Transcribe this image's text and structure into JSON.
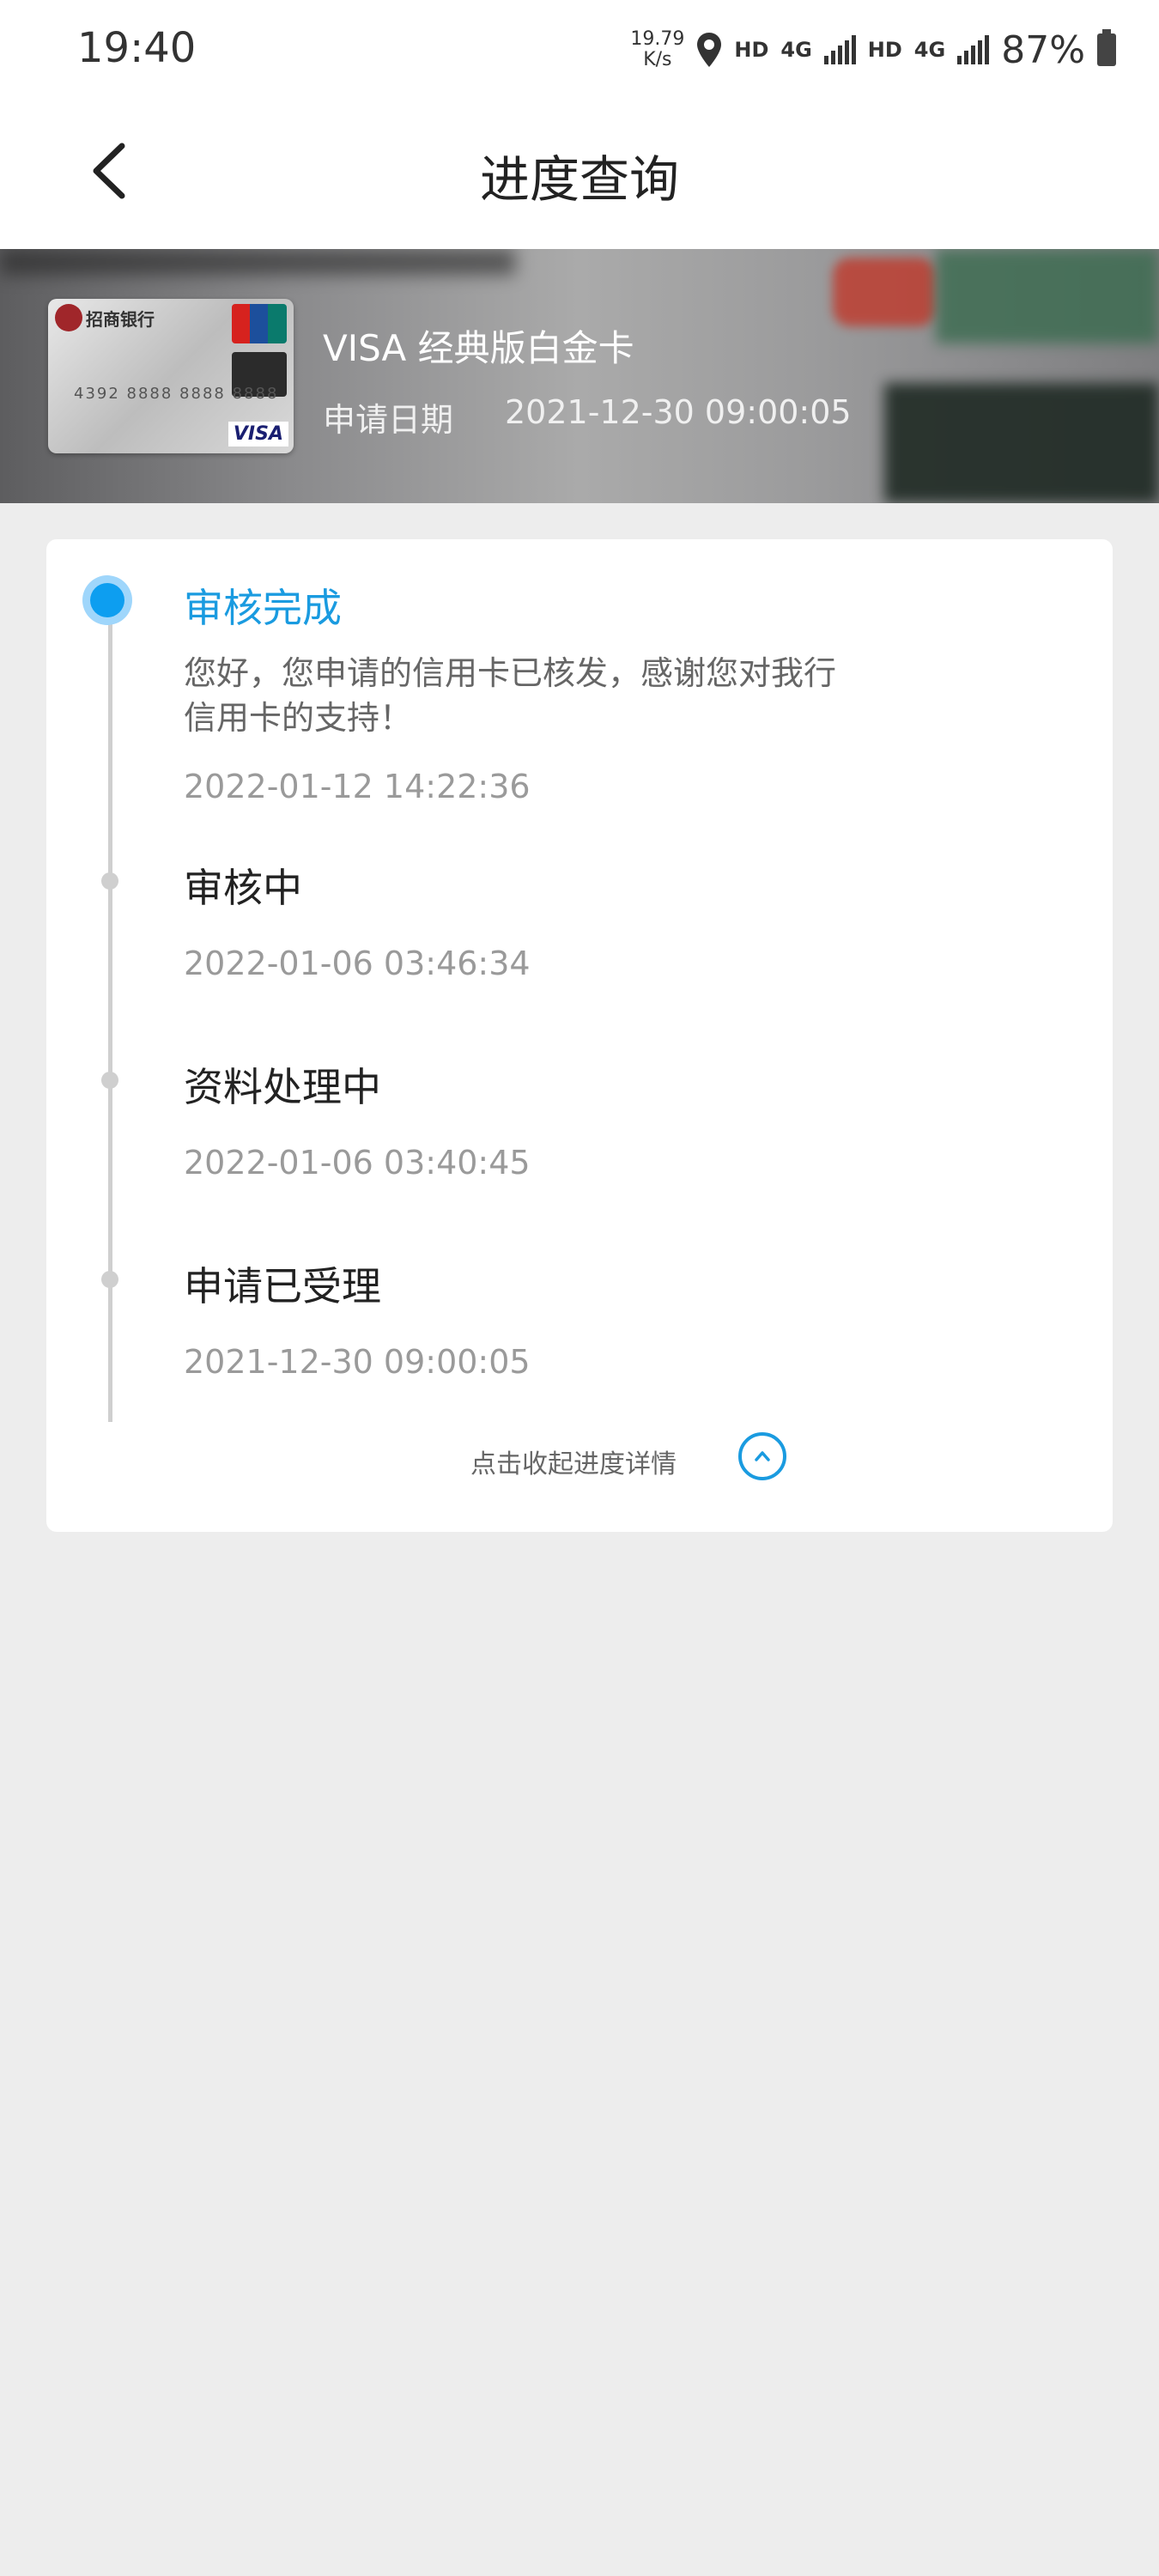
{
  "status_bar": {
    "time": "19:40",
    "speed_value": "19.79",
    "speed_unit": "K/s",
    "hd1": "HD",
    "net1": "4G",
    "hd2": "HD",
    "net2": "4G",
    "battery": "87%"
  },
  "nav": {
    "title": "进度查询",
    "back_icon": "chevron-left-icon"
  },
  "card": {
    "bank_name": "招商银行",
    "card_number": "4392 8888 8888 8888",
    "brand": "VISA",
    "name": "VISA 经典版白金卡",
    "date_label": "申请日期",
    "date_value": "2021-12-30 09:00:05"
  },
  "progress": {
    "steps": [
      {
        "title": "审核完成",
        "desc": "您好，您申请的信用卡已核发，感谢您对我行信用卡的支持！",
        "time": "2022-01-12 14:22:36",
        "active": true
      },
      {
        "title": "审核中",
        "time": "2022-01-06 03:46:34"
      },
      {
        "title": "资料处理中",
        "time": "2022-01-06 03:40:45"
      },
      {
        "title": "申请已受理",
        "time": "2021-12-30 09:00:05"
      }
    ],
    "collapse_label": "点击收起进度详情",
    "accent_color": "#1a9be0"
  }
}
